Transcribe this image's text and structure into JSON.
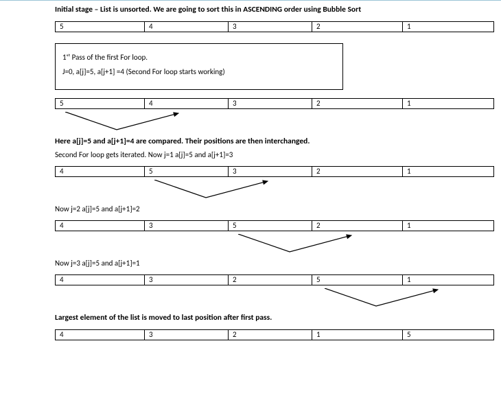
{
  "heading": "Initial stage – List is unsorted. We are going to sort this in ASCENDING order using Bubble Sort",
  "passBox": {
    "line1": "1ˢᵗ Pass of the first For loop.",
    "line2": "J=0, a[j]=5,  a[j+1] =4 (Second For loop starts working)"
  },
  "texts": {
    "compare": "Here a[j]=5 and a[j+1]=4 are compared. Their positions are then interchanged.",
    "iter1": "Second For loop gets iterated. Now j=1  a[j]=5 and a[j+1]=3",
    "iter2": "Now j=2  a[j]=5 and a[j+1]=2",
    "iter3": "Now j=3  a[j]=5 and a[j+1]=1",
    "final": "Largest element of the list is moved to last position after first pass."
  },
  "rows": {
    "r0": [
      "5",
      "4",
      "3",
      "2",
      "1"
    ],
    "r1": [
      "5",
      "4",
      "3",
      "2",
      "1"
    ],
    "r2": [
      "4",
      "5",
      "3",
      "2",
      "1"
    ],
    "r3": [
      "4",
      "3",
      "5",
      "2",
      "1"
    ],
    "r4": [
      "4",
      "3",
      "2",
      "5",
      "1"
    ],
    "r5": [
      "4",
      "3",
      "2",
      "1",
      "5"
    ]
  }
}
